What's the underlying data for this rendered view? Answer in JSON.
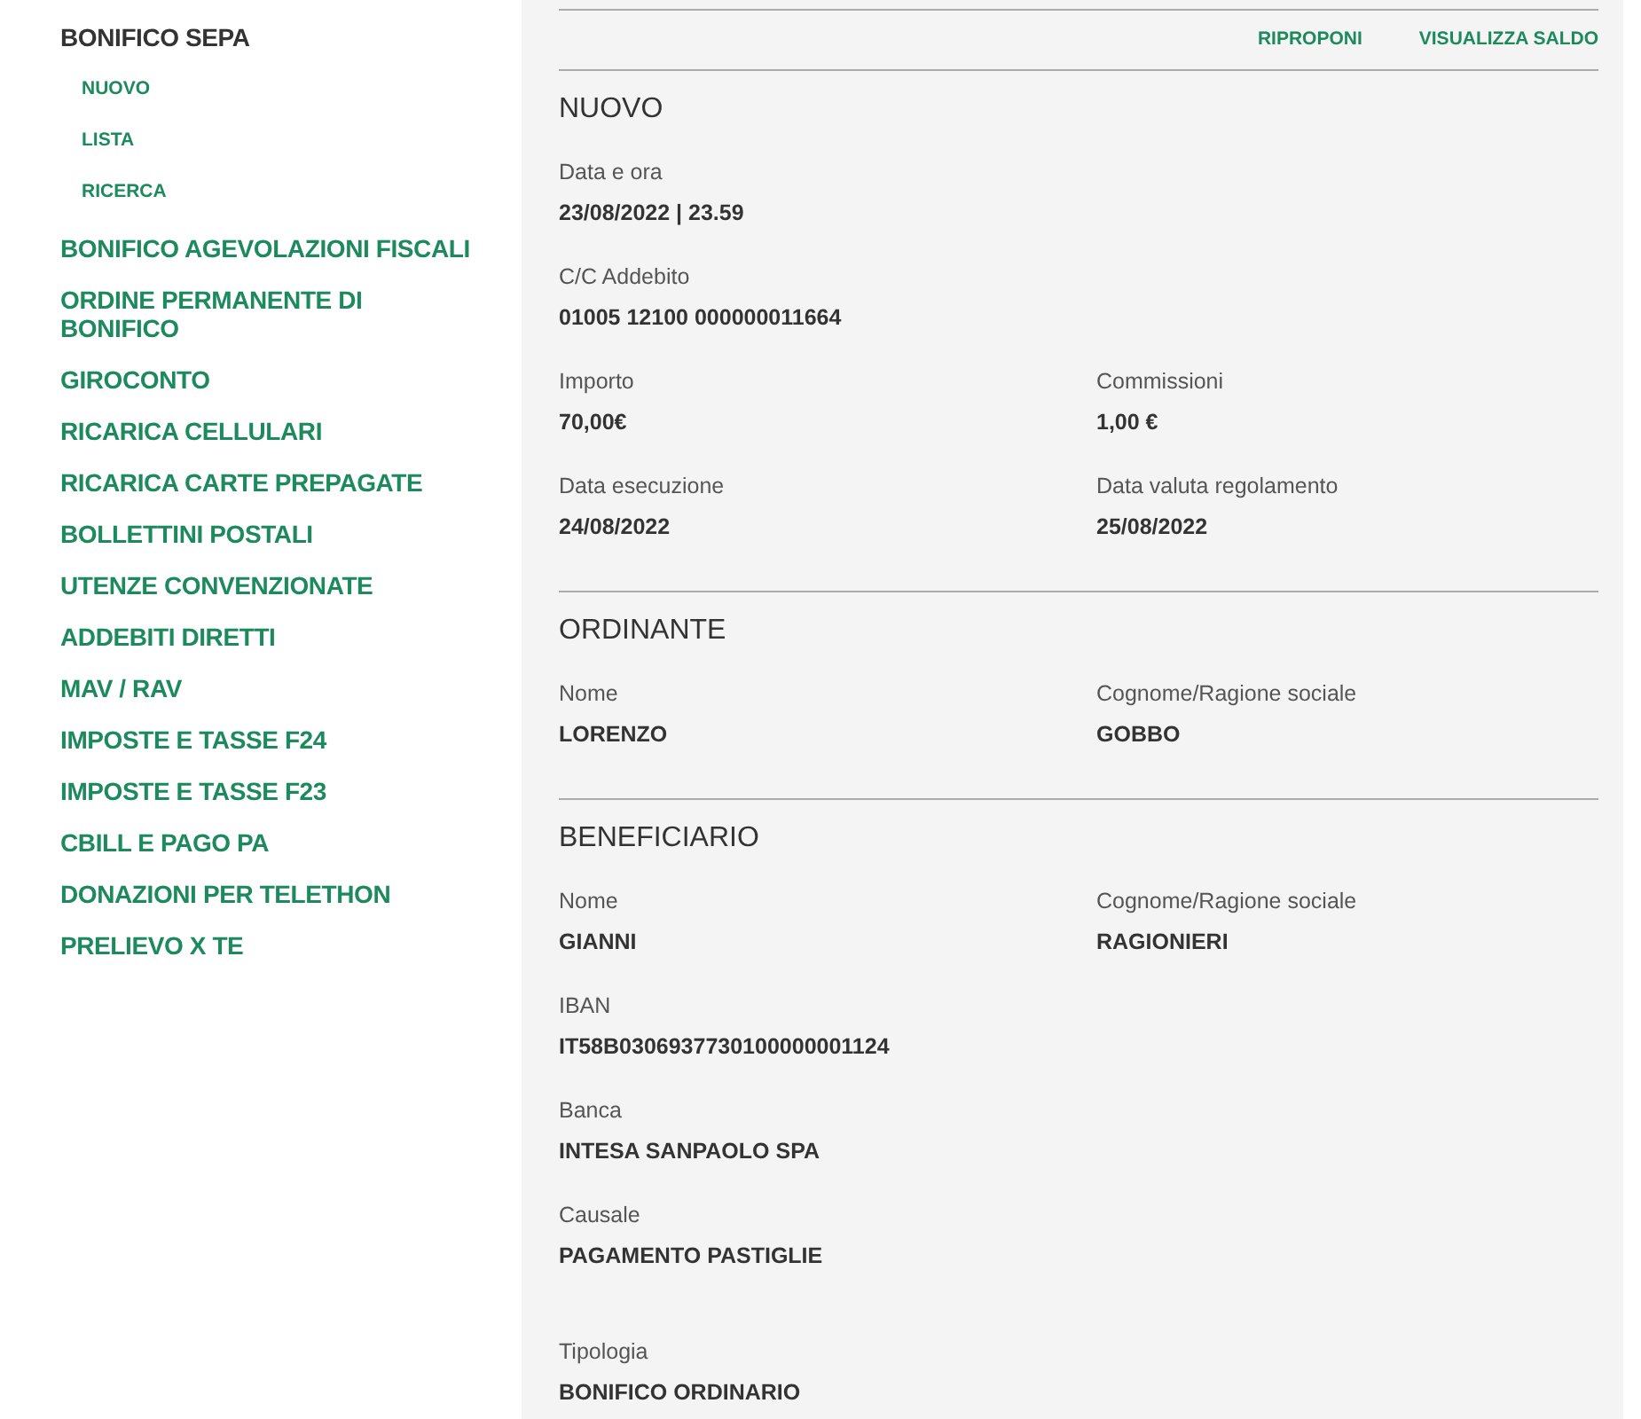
{
  "sidebar": {
    "items": [
      {
        "label": "BONIFICO SEPA",
        "selected": true,
        "children": [
          {
            "label": "NUOVO"
          },
          {
            "label": "LISTA"
          },
          {
            "label": "RICERCA"
          }
        ]
      },
      {
        "label": "BONIFICO AGEVOLAZIONI FISCALI",
        "selected": false
      },
      {
        "label": "ORDINE PERMANENTE DI BONIFICO",
        "selected": false
      },
      {
        "label": "GIROCONTO",
        "selected": false
      },
      {
        "label": "RICARICA CELLULARI",
        "selected": false
      },
      {
        "label": "RICARICA CARTE PREPAGATE",
        "selected": false
      },
      {
        "label": "BOLLETTINI POSTALI",
        "selected": false
      },
      {
        "label": "UTENZE CONVENZIONATE",
        "selected": false
      },
      {
        "label": "ADDEBITI DIRETTI",
        "selected": false
      },
      {
        "label": "MAV / RAV",
        "selected": false
      },
      {
        "label": "IMPOSTE E TASSE F24",
        "selected": false
      },
      {
        "label": "IMPOSTE E TASSE F23",
        "selected": false
      },
      {
        "label": "CBILL E PAGO PA",
        "selected": false
      },
      {
        "label": "DONAZIONI PER TELETHON",
        "selected": false
      },
      {
        "label": "PRELIEVO X TE",
        "selected": false
      }
    ]
  },
  "actions": [
    "RIPROPONI",
    "VISUALIZZA SALDO"
  ],
  "sections": [
    {
      "title": "NUOVO",
      "rows": [
        [
          {
            "label": "Data e ora",
            "value": "23/08/2022 | 23.59"
          }
        ],
        [
          {
            "label": "C/C Addebito",
            "value": "01005 12100 000000011664"
          }
        ],
        [
          {
            "label": "Importo",
            "value": "70,00€"
          },
          {
            "label": "Commissioni",
            "value": "1,00 €"
          }
        ],
        [
          {
            "label": "Data esecuzione",
            "value": "24/08/2022"
          },
          {
            "label": "Data valuta regolamento",
            "value": "25/08/2022"
          }
        ]
      ]
    },
    {
      "title": "ORDINANTE",
      "rows": [
        [
          {
            "label": "Nome",
            "value": "LORENZO"
          },
          {
            "label": "Cognome/Ragione sociale",
            "value": "GOBBO"
          }
        ]
      ]
    },
    {
      "title": "BENEFICIARIO",
      "rows": [
        [
          {
            "label": "Nome",
            "value": "GIANNI"
          },
          {
            "label": "Cognome/Ragione sociale",
            "value": "RAGIONIERI"
          }
        ],
        [
          {
            "label": "IBAN",
            "value": "IT58B0306937730100000001124"
          }
        ],
        [
          {
            "label": "Banca",
            "value": "INTESA SANPAOLO SPA"
          }
        ],
        [
          {
            "label": "Causale",
            "value": "PAGAMENTO PASTIGLIE"
          }
        ]
      ]
    }
  ],
  "footer_fields": [
    {
      "label": "Tipologia",
      "value": "BONIFICO ORDINARIO"
    }
  ]
}
